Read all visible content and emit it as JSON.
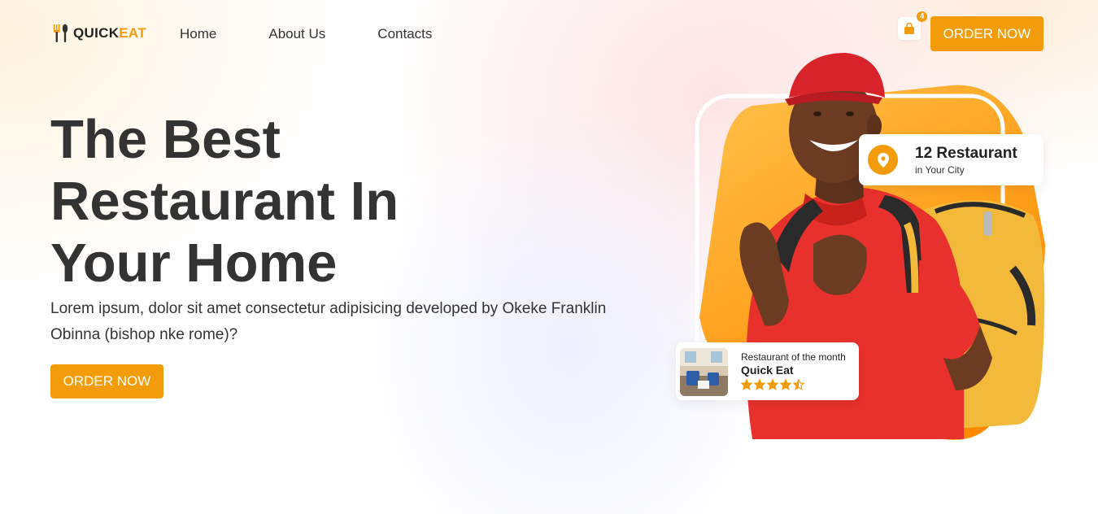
{
  "brand": {
    "name_part1": "QUICK",
    "name_part2": "EAT"
  },
  "nav": {
    "links": [
      "Home",
      "About Us",
      "Contacts"
    ],
    "cart_count": "4",
    "order_button": "ORDER NOW"
  },
  "hero": {
    "title_lines": [
      "The Best",
      "Restaurant In",
      "Your Home"
    ],
    "description": "Lorem ipsum, dolor sit amet consectetur adipisicing developed by Okeke Franklin Obinna (bishop nke rome)?",
    "order_button": "ORDER NOW"
  },
  "stat_card": {
    "icon": "map-pin-icon",
    "title": "12 Restaurant",
    "subtitle": "in Your City"
  },
  "month_card": {
    "label": "Restaurant of the month",
    "name": "Quick Eat",
    "rating": 4.5,
    "rating_max": 5
  },
  "colors": {
    "accent": "#f39c0b",
    "text": "#333333",
    "shirt": "#e8312c",
    "cap": "#d9232a",
    "bag": "#f3b93a"
  }
}
